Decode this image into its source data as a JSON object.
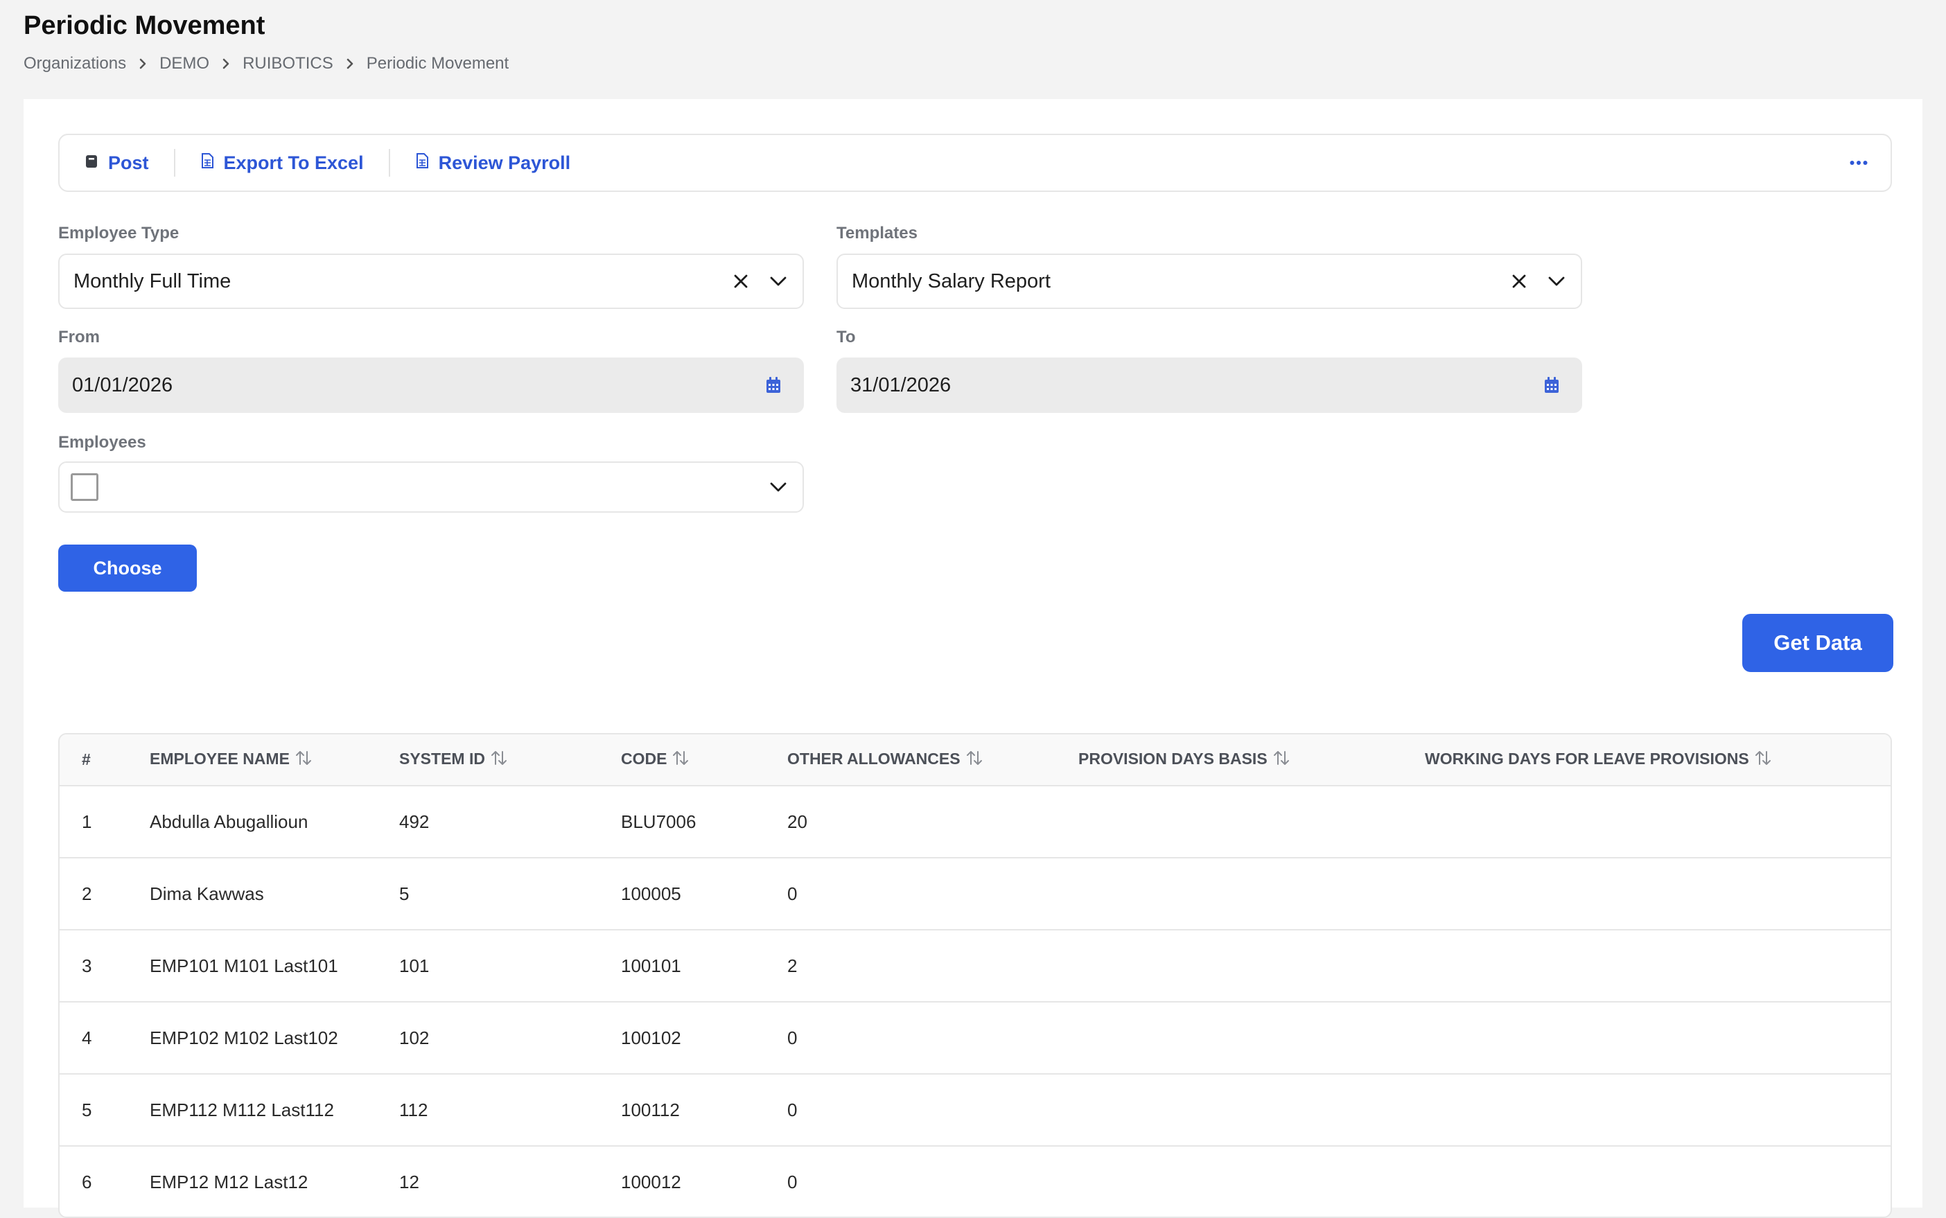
{
  "page": {
    "title": "Periodic Movement",
    "breadcrumb": [
      "Organizations",
      "DEMO",
      "RUIBOTICS",
      "Periodic Movement"
    ]
  },
  "toolbar": {
    "post_label": "Post",
    "export_label": "Export To Excel",
    "review_label": "Review Payroll",
    "more_icon": "ellipsis-icon"
  },
  "form": {
    "employee_type": {
      "label": "Employee Type",
      "value": "Monthly Full Time"
    },
    "templates": {
      "label": "Templates",
      "value": "Monthly Salary Report"
    },
    "from": {
      "label": "From",
      "value": "01/01/2026"
    },
    "to": {
      "label": "To",
      "value": "31/01/2026"
    },
    "employees": {
      "label": "Employees",
      "checked": false
    },
    "choose_label": "Choose",
    "get_data_label": "Get Data"
  },
  "table": {
    "columns": [
      "#",
      "EMPLOYEE NAME",
      "SYSTEM ID",
      "CODE",
      "OTHER ALLOWANCES",
      "PROVISION DAYS BASIS",
      "WORKING DAYS FOR LEAVE PROVISIONS"
    ],
    "rows": [
      [
        "1",
        "Abdulla Abugallioun",
        "492",
        "BLU7006",
        "20",
        "",
        ""
      ],
      [
        "2",
        "Dima Kawwas",
        "5",
        "100005",
        "0",
        "",
        ""
      ],
      [
        "3",
        "EMP101 M101 Last101",
        "101",
        "100101",
        "2",
        "",
        ""
      ],
      [
        "4",
        "EMP102 M102 Last102",
        "102",
        "100102",
        "0",
        "",
        ""
      ],
      [
        "5",
        "EMP112 M112 Last112",
        "112",
        "100112",
        "0",
        "",
        ""
      ],
      [
        "6",
        "EMP12 M12 Last12",
        "12",
        "100012",
        "0",
        "",
        ""
      ]
    ]
  },
  "colors": {
    "accent": "#2f63e6",
    "link": "#2d56d6",
    "background": "#f3f3f3"
  }
}
